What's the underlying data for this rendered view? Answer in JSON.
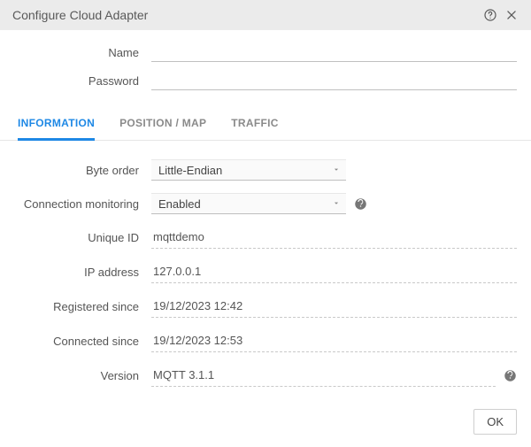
{
  "dialog": {
    "title": "Configure Cloud Adapter"
  },
  "topForm": {
    "nameLabel": "Name",
    "nameValue": "",
    "passwordLabel": "Password",
    "passwordValue": ""
  },
  "tabs": {
    "information": "INFORMATION",
    "positionMap": "POSITION / MAP",
    "traffic": "TRAFFIC",
    "active": "information"
  },
  "info": {
    "byteOrder": {
      "label": "Byte order",
      "value": "Little-Endian"
    },
    "connMon": {
      "label": "Connection monitoring",
      "value": "Enabled"
    },
    "uniqueId": {
      "label": "Unique ID",
      "value": "mqttdemo"
    },
    "ip": {
      "label": "IP address",
      "value": "127.0.0.1"
    },
    "registered": {
      "label": "Registered since",
      "value": "19/12/2023 12:42"
    },
    "connected": {
      "label": "Connected since",
      "value": "19/12/2023 12:53"
    },
    "version": {
      "label": "Version",
      "value": "MQTT 3.1.1"
    }
  },
  "footer": {
    "ok": "OK"
  }
}
